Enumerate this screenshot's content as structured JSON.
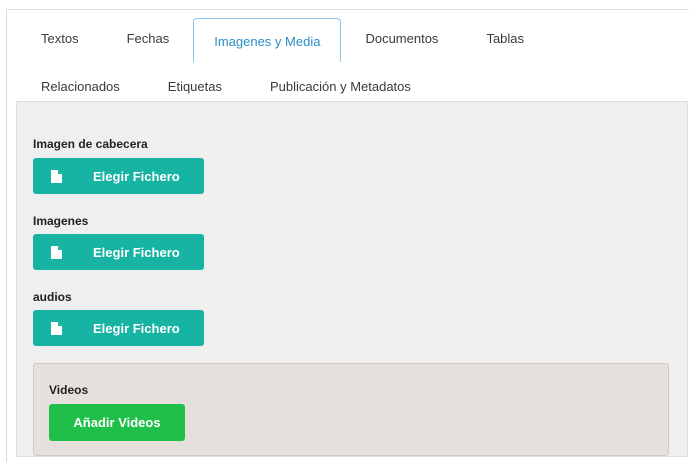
{
  "tabs": {
    "row1": [
      "Textos",
      "Fechas",
      "Imagenes y Media",
      "Documentos",
      "Tablas"
    ],
    "row2": [
      "Relacionados",
      "Etiquetas",
      "Publicación y Metadatos"
    ],
    "active": "Imagenes y Media"
  },
  "fields": {
    "header_image": {
      "label": "Imagen de cabecera",
      "button": "Elegir Fichero"
    },
    "images": {
      "label": "Imagenes",
      "button": "Elegir Fichero"
    },
    "audios": {
      "label": "audios",
      "button": "Elegir Fichero"
    }
  },
  "videos": {
    "label": "Videos",
    "button": "Añadir Videos"
  },
  "icons": {
    "file_button": "file-icon"
  },
  "colors": {
    "file_button": "#17b3a3",
    "add_button": "#1fbf4a",
    "active_tab_text": "#2b8ec7",
    "active_tab_border": "#8fc3e6",
    "panel_bg": "#f0efef",
    "videos_bg": "#e6e0dd"
  }
}
